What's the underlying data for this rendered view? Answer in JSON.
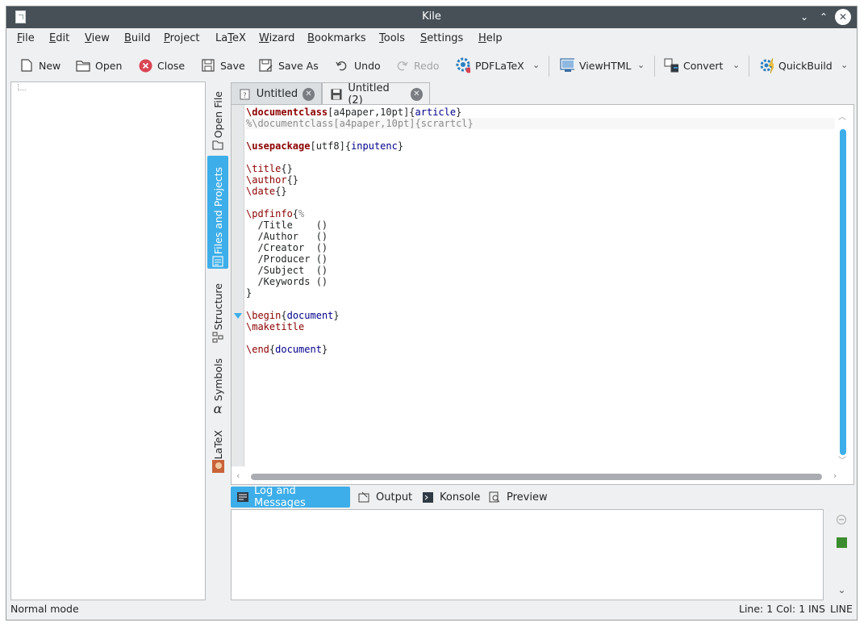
{
  "window": {
    "title": "Kile",
    "controls": {
      "minimize": "⌄",
      "maximize": "⌃",
      "close": "✕"
    }
  },
  "menu": [
    {
      "pre": "",
      "u": "F",
      "post": "ile"
    },
    {
      "pre": "",
      "u": "E",
      "post": "dit"
    },
    {
      "pre": "",
      "u": "V",
      "post": "iew"
    },
    {
      "pre": "",
      "u": "B",
      "post": "uild"
    },
    {
      "pre": "",
      "u": "P",
      "post": "roject"
    },
    {
      "pre": "La",
      "u": "T",
      "post": "eX"
    },
    {
      "pre": "",
      "u": "W",
      "post": "izard"
    },
    {
      "pre": "",
      "u": "B",
      "post": "ookmarks"
    },
    {
      "pre": "",
      "u": "T",
      "post": "ools"
    },
    {
      "pre": "",
      "u": "S",
      "post": "ettings"
    },
    {
      "pre": "",
      "u": "H",
      "post": "elp"
    }
  ],
  "toolbar": {
    "new": "New",
    "open": "Open",
    "close": "Close",
    "save": "Save",
    "save_as": "Save As",
    "undo": "Undo",
    "redo": "Redo",
    "pdflatex": "PDFLaTeX",
    "viewhtml": "ViewHTML",
    "convert": "Convert",
    "quickbuild": "QuickBuild"
  },
  "side_tabs": [
    "Open File",
    "Files and Projects",
    "Structure",
    "Symbols",
    "LaTeX"
  ],
  "doc_tabs": [
    "Untitled",
    "Untitled (2)"
  ],
  "code_lines": [
    [
      [
        "kw",
        "\\documentclass"
      ],
      [
        "plain",
        "[a4paper,10pt]{"
      ],
      [
        "arg",
        "article"
      ],
      [
        "plain",
        "}"
      ]
    ],
    [
      [
        "cm",
        "%\\documentclass[a4paper,10pt]{scrartcl}"
      ]
    ],
    [],
    [
      [
        "kw",
        "\\usepackage"
      ],
      [
        "plain",
        "[utf8]{"
      ],
      [
        "arg",
        "inputenc"
      ],
      [
        "plain",
        "}"
      ]
    ],
    [],
    [
      [
        "cmd",
        "\\title"
      ],
      [
        "plain",
        "{}"
      ]
    ],
    [
      [
        "cmd",
        "\\author"
      ],
      [
        "plain",
        "{}"
      ]
    ],
    [
      [
        "cmd",
        "\\date"
      ],
      [
        "plain",
        "{}"
      ]
    ],
    [],
    [
      [
        "cmd",
        "\\pdfinfo"
      ],
      [
        "plain",
        "{"
      ],
      [
        "cm",
        "%"
      ]
    ],
    [
      [
        "plain",
        "  /Title    ()"
      ]
    ],
    [
      [
        "plain",
        "  /Author   ()"
      ]
    ],
    [
      [
        "plain",
        "  /Creator  ()"
      ]
    ],
    [
      [
        "plain",
        "  /Producer ()"
      ]
    ],
    [
      [
        "plain",
        "  /Subject  ()"
      ]
    ],
    [
      [
        "plain",
        "  /Keywords ()"
      ]
    ],
    [
      [
        "plain",
        "}"
      ]
    ],
    [],
    [
      [
        "cmd",
        "\\begin"
      ],
      [
        "plain",
        "{"
      ],
      [
        "arg",
        "document"
      ],
      [
        "plain",
        "}"
      ]
    ],
    [
      [
        "cmd",
        "\\maketitle"
      ]
    ],
    [],
    [
      [
        "cmd",
        "\\end"
      ],
      [
        "plain",
        "{"
      ],
      [
        "arg",
        "document"
      ],
      [
        "plain",
        "}"
      ]
    ]
  ],
  "bottom_tabs": [
    "Log and Messages",
    "Output",
    "Konsole",
    "Preview"
  ],
  "status": {
    "mode": "Normal mode",
    "position": "Line: 1 Col: 1",
    "ins": "INS",
    "line": "LINE"
  },
  "colors": {
    "accent": "#3daee9",
    "titlebar": "#475057",
    "keyword": "#8b0000",
    "argument": "#00008b",
    "comment": "#8a8a8a"
  },
  "icons": {
    "app": "kile-app-icon",
    "new": "new-document-icon",
    "open": "folder-open-icon",
    "close": "close-document-icon",
    "save": "save-icon",
    "save_as": "save-as-icon",
    "undo": "undo-icon",
    "redo": "redo-icon",
    "pdflatex": "gear-build-icon",
    "viewhtml": "view-html-icon",
    "convert": "convert-icon",
    "quickbuild": "quickbuild-icon"
  }
}
